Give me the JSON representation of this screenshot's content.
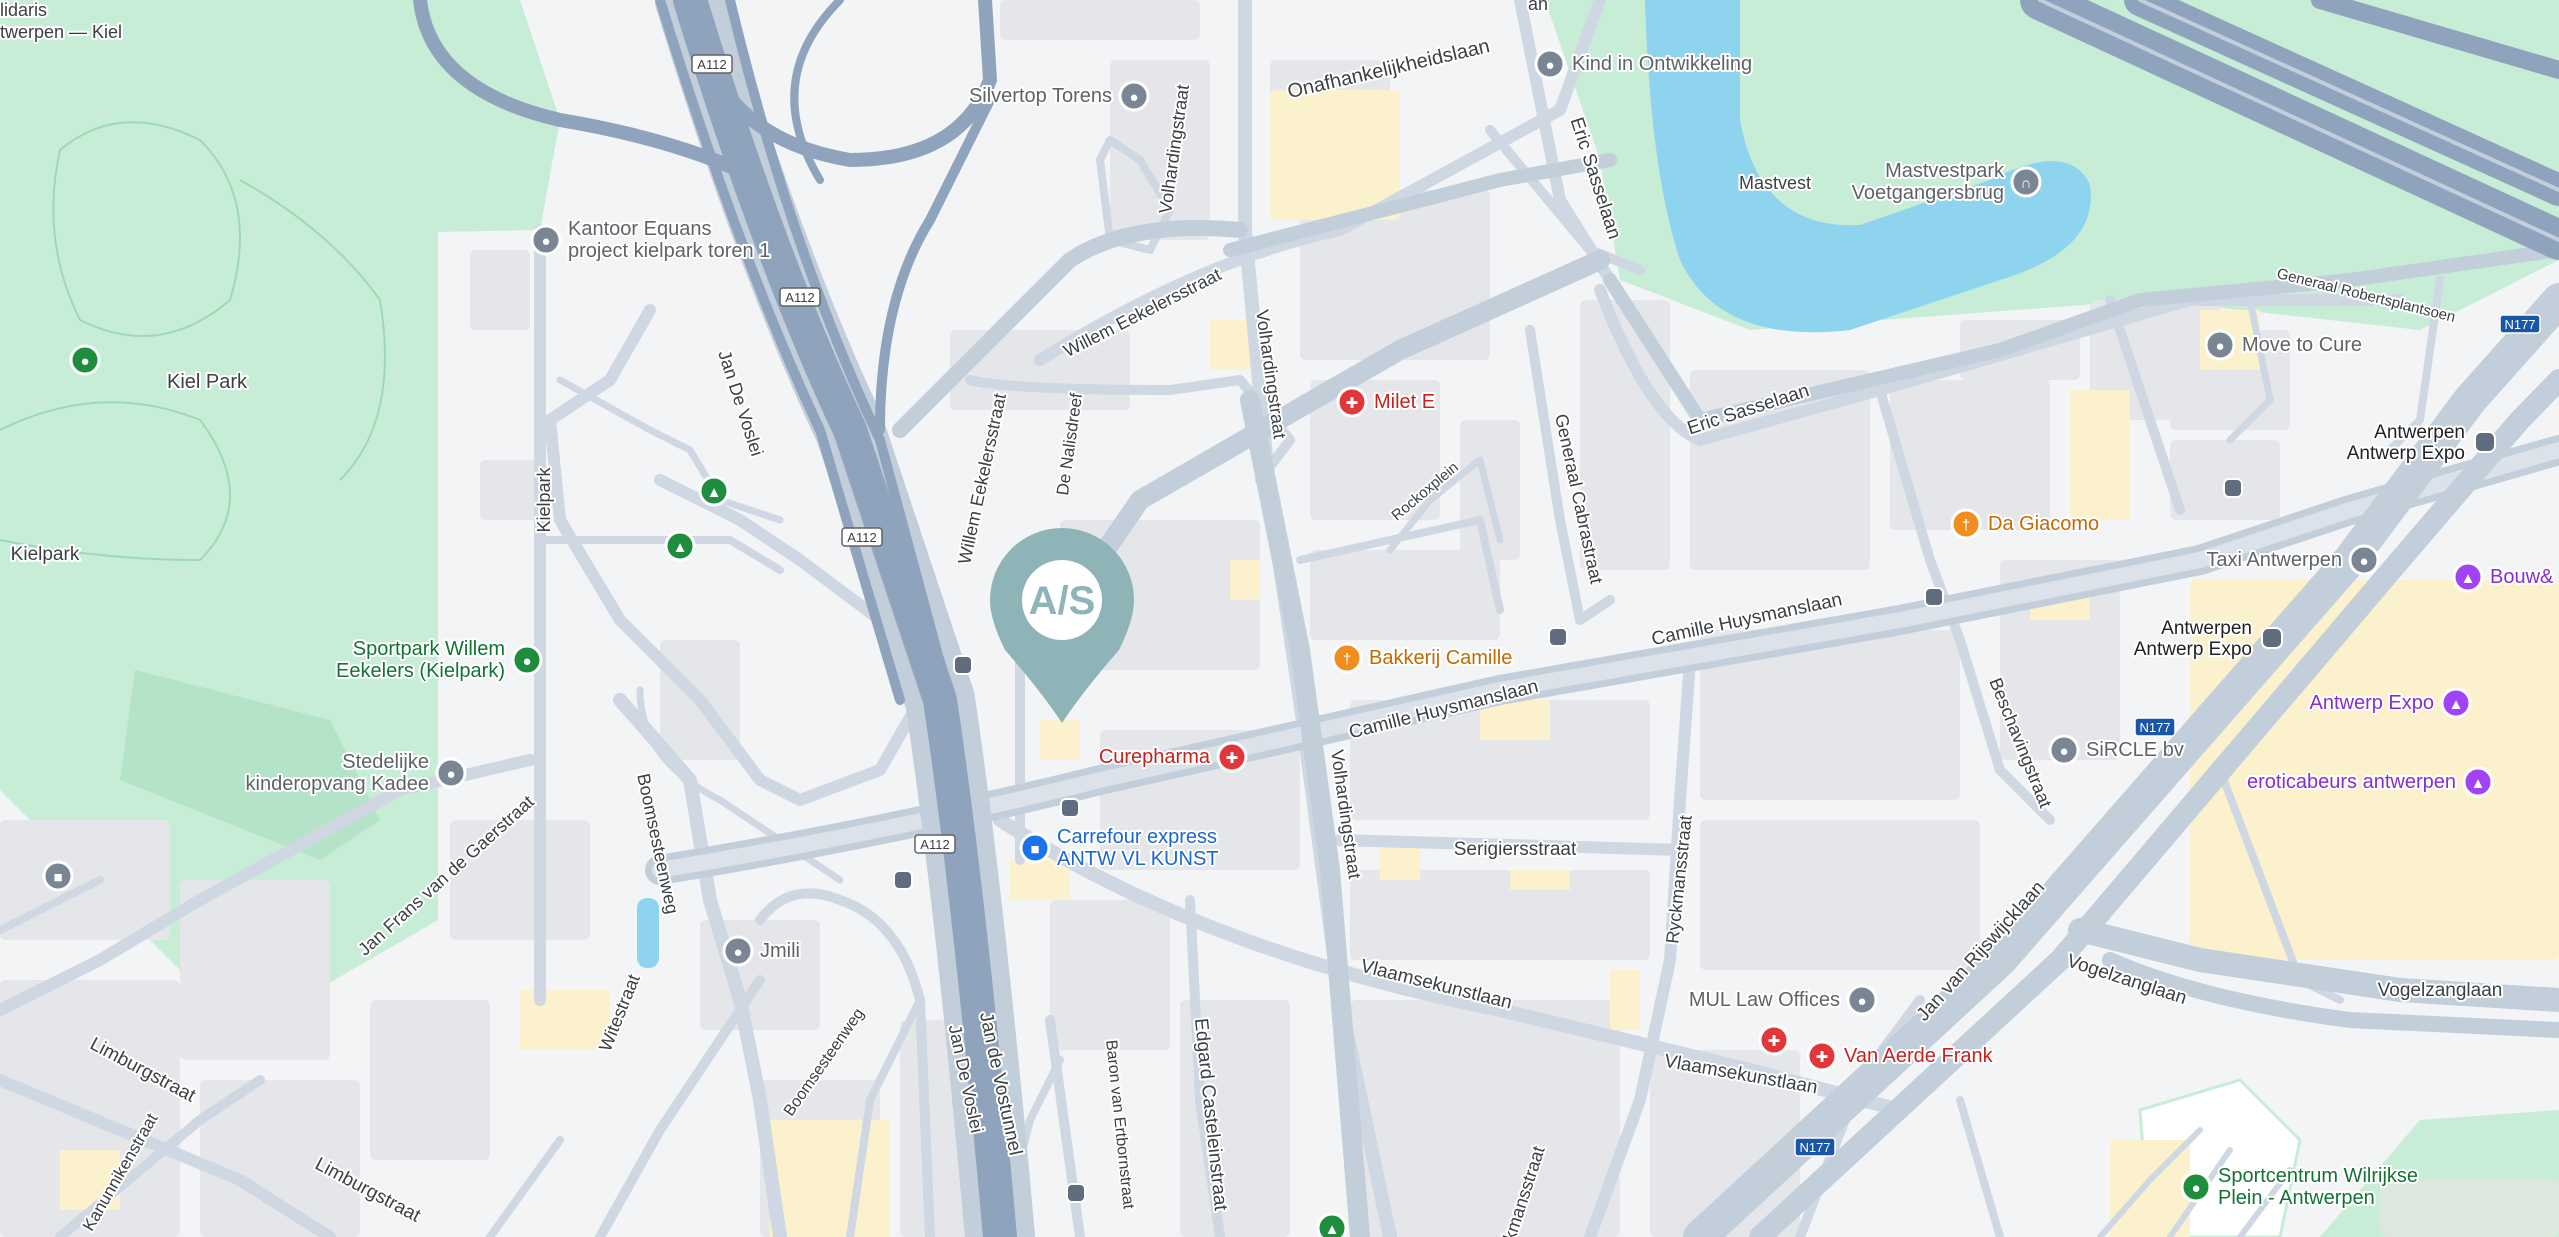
{
  "colors": {
    "background": "#f3f4f6",
    "park": "#c8edd7",
    "park_dark": "#b5e3c8",
    "water": "#8fd4ee",
    "block": "#e4e6ea",
    "block_yellow": "#fbf1cd",
    "road_minor": "#cfd7e2",
    "road_major": "#a9b8cc",
    "highway": "#8fa3bd",
    "text_street": "#3c4043",
    "text_poi_gray": "#5f6368",
    "text_red": "#c5221f",
    "text_orange": "#c36a00",
    "text_blue": "#1967d2",
    "text_purple": "#8430ce",
    "text_green": "#137333",
    "marker": "#8fb4b8"
  },
  "marker": {
    "logo_text": "A/S",
    "name": "location-pin"
  },
  "streets": [
    {
      "name": "street-onafhankelijkheidslaan",
      "text": "Onafhankelijkheidslaan"
    },
    {
      "name": "street-volhardingstraat-north",
      "text": "Volhardingstraat"
    },
    {
      "name": "street-willem-eekelersstraat-a",
      "text": "Willem Eekelersstraat"
    },
    {
      "name": "street-willem-eekelersstraat-b",
      "text": "Willem Eekelersstraat"
    },
    {
      "name": "street-de-nalisdreef",
      "text": "De Nalisdreef"
    },
    {
      "name": "street-volhardingstraat-mid",
      "text": "Volhardingstraat"
    },
    {
      "name": "street-eric-sasselaan-north",
      "text": "Eric Sasselaan"
    },
    {
      "name": "street-eric-sasselaan",
      "text": "Eric Sasselaan"
    },
    {
      "name": "street-generaal-cabrastraat",
      "text": "Generaal Cabrastraat"
    },
    {
      "name": "street-rockoxplein",
      "text": "Rockoxplein"
    },
    {
      "name": "street-camille-huysmanslaan-east",
      "text": "Camille Huysmanslaan"
    },
    {
      "name": "street-camille-huysmanslaan",
      "text": "Camille Huysmanslaan"
    },
    {
      "name": "street-jan-de-voslei-north",
      "text": "Jan De Voslei"
    },
    {
      "name": "street-kielpark",
      "text": "Kielpark"
    },
    {
      "name": "street-boomsesteenweg",
      "text": "Boomsesteenweg"
    },
    {
      "name": "street-jan-frans-van-de-gaerstraat",
      "text": "Jan Frans van de Gaerstraat"
    },
    {
      "name": "street-serigiersstraat",
      "text": "Serigiersstraat"
    },
    {
      "name": "street-volhardingstraat-south",
      "text": "Volhardingstraat"
    },
    {
      "name": "street-vlaamsekunstlaan",
      "text": "Vlaamsekunstlaan"
    },
    {
      "name": "street-vlaamsekunstlaan-east",
      "text": "Vlaamsekunstlaan"
    },
    {
      "name": "street-ryckmansstraat",
      "text": "Ryckmansstraat"
    },
    {
      "name": "street-beschavingstraat",
      "text": "Beschavingstraat"
    },
    {
      "name": "street-jan-van-rijswijcklaan",
      "text": "Jan van Rijswijcklaan"
    },
    {
      "name": "street-vogelzanglaan",
      "text": "Vogelzanglaan"
    },
    {
      "name": "street-vogelzanglaan-east",
      "text": "Vogelzanglaan"
    },
    {
      "name": "street-generaal-robertsplantsoen",
      "text": "Generaal Robertsplantsoen"
    },
    {
      "name": "street-witestraat",
      "text": "Witestraat"
    },
    {
      "name": "street-boomsesteenweg-south",
      "text": "Boomsesteenweg"
    },
    {
      "name": "street-jan-de-voslei-south",
      "text": "Jan De Voslei"
    },
    {
      "name": "street-jan-de-vostunnel",
      "text": "Jan de Vostunnel"
    },
    {
      "name": "street-baron-van-ertbornstraat",
      "text": "Baron van Ertbornstraat"
    },
    {
      "name": "street-edgard-casteleinstraat",
      "text": "Edgard Casteleinstraat"
    },
    {
      "name": "street-limburgstraat",
      "text": "Limburgstraat"
    },
    {
      "name": "street-limburgstraat-south",
      "text": "Limburgstraat"
    },
    {
      "name": "street-kanunnikenstraat",
      "text": "Kanunnikenstraat"
    },
    {
      "name": "street-ryckmansstraat-south",
      "text": "Ryckmansstraat"
    },
    {
      "name": "street-fragment-an",
      "text": "an"
    }
  ],
  "road_shields": [
    {
      "name": "shield-a112-1",
      "text": "A112"
    },
    {
      "name": "shield-a112-2",
      "text": "A112"
    },
    {
      "name": "shield-a112-3",
      "text": "A112"
    },
    {
      "name": "shield-a112-4",
      "text": "A112"
    },
    {
      "name": "shield-n177-1",
      "text": "N177"
    },
    {
      "name": "shield-n177-2",
      "text": "N177"
    },
    {
      "name": "shield-n177-3",
      "text": "N177"
    }
  ],
  "pois": [
    {
      "name": "poi-silvertop-torens",
      "lines": [
        "Silvertop Torens"
      ],
      "icon": "pin-icon",
      "color": "gray"
    },
    {
      "name": "poi-kind-in-ontwikkeling",
      "lines": [
        "Kind in Ontwikkeling"
      ],
      "icon": "pin-icon",
      "color": "gray"
    },
    {
      "name": "poi-kantoor-equans",
      "lines": [
        "Kantoor Equans",
        "project kielpark toren 1"
      ],
      "icon": "pin-icon",
      "color": "gray"
    },
    {
      "name": "poi-mastvestpark-voetgangersbrug",
      "lines": [
        "Mastvestpark",
        "Voetgangersbrug"
      ],
      "icon": "bridge-icon",
      "color": "gray"
    },
    {
      "name": "poi-milet-e",
      "lines": [
        "Milet E"
      ],
      "icon": "hospital-icon",
      "color": "red"
    },
    {
      "name": "poi-move-to-cure",
      "lines": [
        "Move to Cure"
      ],
      "icon": "pin-icon",
      "color": "gray"
    },
    {
      "name": "poi-da-giacomo",
      "lines": [
        "Da Giacomo"
      ],
      "icon": "restaurant-icon",
      "color": "orange"
    },
    {
      "name": "poi-taxi-antwerpen",
      "lines": [
        "Taxi Antwerpen"
      ],
      "icon": "pin-icon",
      "color": "gray"
    },
    {
      "name": "poi-bakkerij-camille",
      "lines": [
        "Bakkerij Camille"
      ],
      "icon": "restaurant-icon",
      "color": "orange"
    },
    {
      "name": "poi-curepharma",
      "lines": [
        "Curepharma"
      ],
      "icon": "pharmacy-icon",
      "color": "red"
    },
    {
      "name": "poi-carrefour-express",
      "lines": [
        "Carrefour express",
        "ANTW VL KUNST"
      ],
      "icon": "shopping-cart-icon",
      "color": "blue"
    },
    {
      "name": "poi-sircle-bv",
      "lines": [
        "SiRCLE bv"
      ],
      "icon": "pin-icon",
      "color": "gray"
    },
    {
      "name": "poi-antwerp-expo",
      "lines": [
        "Antwerp Expo"
      ],
      "icon": "landmark-icon",
      "color": "purple"
    },
    {
      "name": "poi-eroticabeurs-antwerpen",
      "lines": [
        "eroticabeurs antwerpen"
      ],
      "icon": "landmark-icon",
      "color": "purple"
    },
    {
      "name": "poi-bouw",
      "lines": [
        "Bouw&"
      ],
      "icon": "landmark-icon",
      "color": "purple"
    },
    {
      "name": "poi-mul-law-offices",
      "lines": [
        "MUL Law Offices"
      ],
      "icon": "pin-icon",
      "color": "gray"
    },
    {
      "name": "poi-van-aerde-frank",
      "lines": [
        "Van Aerde Frank"
      ],
      "icon": "hospital-icon",
      "color": "red"
    },
    {
      "name": "poi-jmili",
      "lines": [
        "Jmili"
      ],
      "icon": "pin-icon",
      "color": "gray"
    },
    {
      "name": "poi-stedelijke-kinderopvang",
      "lines": [
        "Stedelijke",
        "kinderopvang Kadee"
      ],
      "icon": "pin-icon",
      "color": "gray"
    },
    {
      "name": "poi-sportpark-willem-eekelers",
      "lines": [
        "Sportpark Willem",
        "Eekelers (Kielpark)"
      ],
      "icon": "park-icon",
      "color": "green"
    },
    {
      "name": "poi-sportcentrum-wilrijkse-plein",
      "lines": [
        "Sportcentrum Wilrijkse",
        "Plein - Antwerpen"
      ],
      "icon": "park-icon",
      "color": "green"
    },
    {
      "name": "poi-kiel-park-marker",
      "lines": [],
      "icon": "park-icon",
      "color": "green"
    },
    {
      "name": "poi-tree-1",
      "lines": [],
      "icon": "tree-icon",
      "color": "green"
    },
    {
      "name": "poi-tree-2",
      "lines": [],
      "icon": "tree-icon",
      "color": "green"
    },
    {
      "name": "poi-tree-3",
      "lines": [],
      "icon": "tree-icon",
      "color": "green"
    },
    {
      "name": "poi-school",
      "lines": [],
      "icon": "school-icon",
      "color": "gray"
    },
    {
      "name": "poi-hospital-small",
      "lines": [],
      "icon": "hospital-icon",
      "color": "red"
    }
  ],
  "transit": [
    {
      "name": "transit-antwerpen-antwerp-expo-1",
      "lines": [
        "Antwerpen",
        "Antwerp Expo"
      ]
    },
    {
      "name": "transit-antwerpen-antwerp-expo-2",
      "lines": [
        "Antwerpen",
        "Antwerp Expo"
      ]
    }
  ],
  "areas": [
    {
      "name": "area-kiel-park",
      "text": "Kiel Park"
    },
    {
      "name": "area-kielpark",
      "text": "Kielpark"
    },
    {
      "name": "area-mastvest",
      "text": "Mastvest"
    },
    {
      "name": "area-solidaris",
      "lines": [
        "lidaris",
        "twerpen — Kiel"
      ]
    }
  ]
}
